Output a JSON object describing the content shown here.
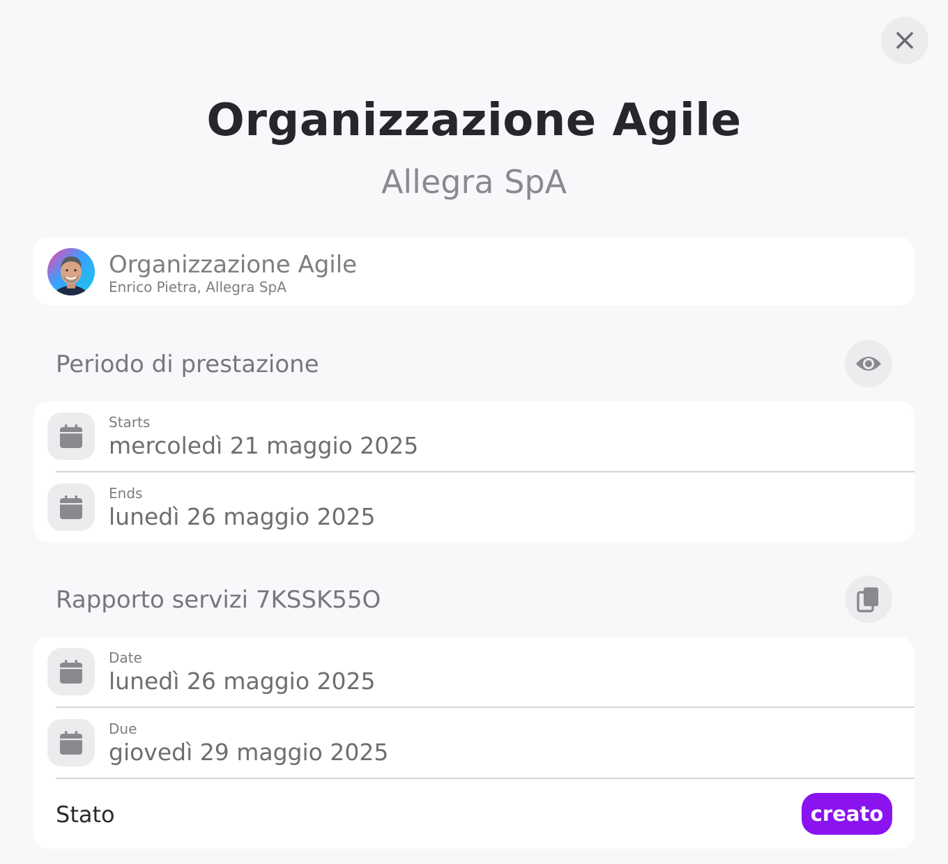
{
  "header": {
    "title": "Organizzazione Agile",
    "subtitle": "Allegra SpA",
    "close_icon": "close-icon"
  },
  "profile": {
    "name": "Organizzazione Agile",
    "sub": "Enrico Pietra, Allegra SpA",
    "avatar_icon": "avatar"
  },
  "periodo": {
    "title": "Periodo di prestazione",
    "action_icon": "eye-icon",
    "rows": [
      {
        "label": "Starts",
        "value": "mercoledì 21 maggio 2025",
        "icon": "calendar-icon"
      },
      {
        "label": "Ends",
        "value": "lunedì 26 maggio 2025",
        "icon": "calendar-icon"
      }
    ]
  },
  "rapporto": {
    "title": "Rapporto servizi 7KSSK55O",
    "action_icon": "copy-icon",
    "rows": [
      {
        "label": "Date",
        "value": "lunedì 26 maggio 2025",
        "icon": "calendar-icon"
      },
      {
        "label": "Due",
        "value": "giovedì 29 maggio 2025",
        "icon": "calendar-icon"
      }
    ],
    "status_label": "Stato",
    "status_value": "creato"
  },
  "colors": {
    "accent": "#8a13ef",
    "background": "#f7f8fa",
    "card": "#ffffff",
    "icon_bg": "#ececee"
  }
}
